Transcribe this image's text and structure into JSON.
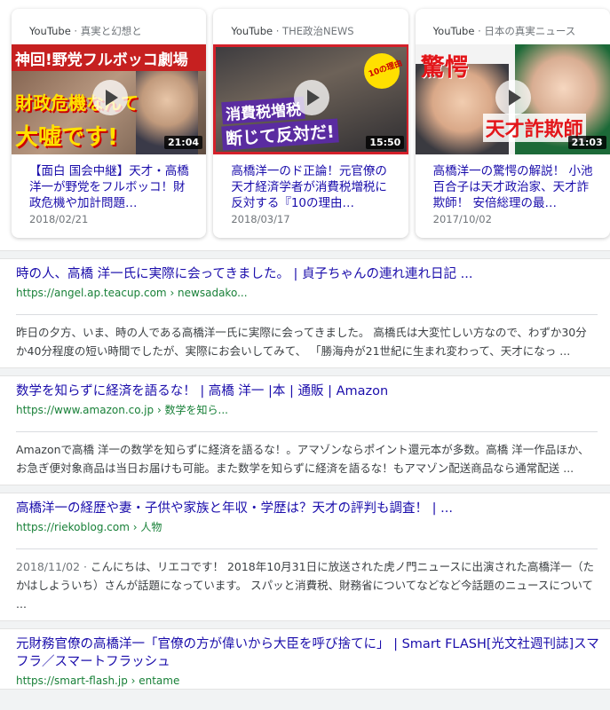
{
  "videos": [
    {
      "source": "YouTube",
      "channel": " · 真実と幻想と",
      "caption_top": "神回!野党フルボッコ劇場",
      "caption_mid": "財政危機なんて",
      "caption_bottom": "大嘘です!",
      "duration": "21:04",
      "title": "【面白 国会中継】天才・高橋洋一が野党をフルボッコ！財政危機や加計問題…",
      "date": "2018/02/21"
    },
    {
      "source": "YouTube",
      "channel": " · THE政治NEWS",
      "caption_badge": "10の理由",
      "caption_mid": "消費税増税",
      "caption_bottom": "断じて反対だ!",
      "duration": "15:50",
      "title": "高橋洋一のド正論！元官僚の天才経済学者が消費税増税に反対する『10の理由…",
      "date": "2018/03/17"
    },
    {
      "source": "YouTube",
      "channel": " · 日本の真実ニュース",
      "caption_top": "驚愕",
      "caption_bottom": "天才詐欺師",
      "duration": "21:03",
      "title": "高橋洋一の驚愕の解説！ 小池百合子は天才政治家、天才詐欺師！ 安倍総理の最…",
      "date": "2017/10/02"
    }
  ],
  "results": [
    {
      "title": "時の人、高橋 洋一氏に実際に会ってきました。 | 貞子ちゃんの連れ連れ日記 ...",
      "url_domain": "https://angel.ap.teacup.com",
      "url_path": " › newsadako...",
      "date": "",
      "snippet": "昨日の夕方、いま、時の人である高橋洋一氏に実際に会ってきました。 高橋氏は大変忙しい方なので、わずか30分か40分程度の短い時間でしたが、実際にお会いしてみて、 「勝海舟が21世紀に生まれ変わって、天才になっ ..."
    },
    {
      "title": "数学を知らずに経済を語るな！ | 高橋 洋一 |本 | 通販 | Amazon",
      "url_domain": "https://www.amazon.co.jp",
      "url_path": " › 数学を知ら...",
      "date": "",
      "snippet": "Amazonで高橋 洋一の数学を知らずに経済を語るな！。アマゾンならポイント還元本が多数。高橋 洋一作品ほか、お急ぎ便対象商品は当日お届けも可能。また数学を知らずに経済を語るな！もアマゾン配送商品なら通常配送 ..."
    },
    {
      "title": "高橋洋一の経歴や妻・子供や家族と年収・学歴は？天才の評判も調査！ | ...",
      "url_domain": "https://riekoblog.com",
      "url_path": " › 人物",
      "date": "2018/11/02 · ",
      "snippet": "こんにちは、リエコです！ 2018年10月31日に放送された虎ノ門ニュースに出演された高橋洋一（たかはしよういち）さんが話題になっています。 スパッと消費税、財務省についてなどなど今話題のニュースについて ..."
    },
    {
      "title": "元財務官僚の高橋洋一「官僚の方が偉いから大臣を呼び捨てに」 | Smart FLASH[光文社週刊誌]スマフラ／スマートフラッシュ",
      "url_domain": "https://smart-flash.jp",
      "url_path": " › entame",
      "date": "",
      "snippet": ""
    }
  ],
  "colors": {
    "link": "#1a0dab",
    "url_green": "#188038",
    "snippet": "#3c4043",
    "muted": "#70757a"
  }
}
